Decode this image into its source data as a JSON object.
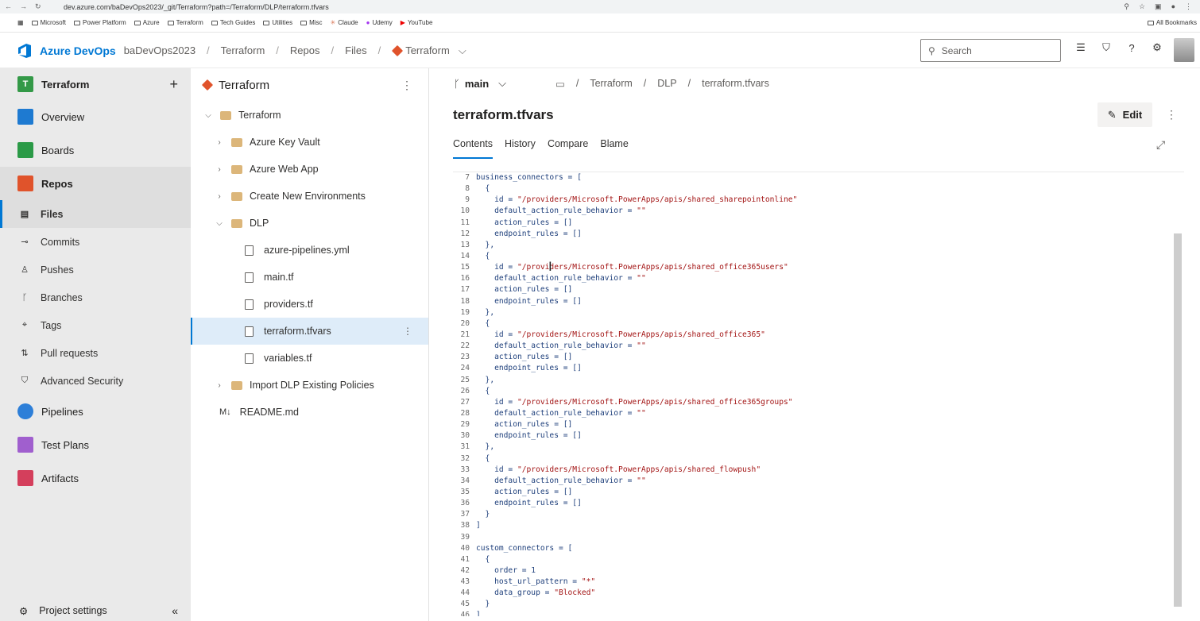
{
  "browser": {
    "url": "dev.azure.com/baDevOps2023/_git/Terraform?path=/Terraform/DLP/terraform.tfvars",
    "bookmarks": [
      "Microsoft",
      "Power Platform",
      "Azure",
      "Terraform",
      "Tech Guides",
      "Utilities",
      "Misc",
      "Claude",
      "Udemy",
      "YouTube"
    ],
    "all_bookmarks": "All Bookmarks"
  },
  "header": {
    "brand": "Azure DevOps",
    "org": "baDevOps2023",
    "project": "Terraform",
    "section": "Repos",
    "subsection": "Files",
    "repo": "Terraform",
    "search_placeholder": "Search"
  },
  "sidebar": {
    "project_initial": "T",
    "project_name": "Terraform",
    "items": {
      "overview": "Overview",
      "boards": "Boards",
      "repos": "Repos",
      "files": "Files",
      "commits": "Commits",
      "pushes": "Pushes",
      "branches": "Branches",
      "tags": "Tags",
      "pull_requests": "Pull requests",
      "advanced_security": "Advanced Security",
      "pipelines": "Pipelines",
      "test_plans": "Test Plans",
      "artifacts": "Artifacts"
    },
    "settings": "Project settings"
  },
  "tree": {
    "repo_name": "Terraform",
    "root": "Terraform",
    "folders": {
      "key_vault": "Azure Key Vault",
      "web_app": "Azure Web App",
      "new_env": "Create New Environments",
      "dlp": "DLP",
      "import": "Import DLP Existing Policies"
    },
    "files": {
      "pipelines": "azure-pipelines.yml",
      "main": "main.tf",
      "providers": "providers.tf",
      "tfvars": "terraform.tfvars",
      "variables": "variables.tf",
      "readme": "README.md"
    }
  },
  "main": {
    "branch": "main",
    "path": {
      "p1": "Terraform",
      "p2": "DLP",
      "p3": "terraform.tfvars"
    },
    "file_title": "terraform.tfvars",
    "edit_label": "Edit",
    "tabs": {
      "contents": "Contents",
      "history": "History",
      "compare": "Compare",
      "blame": "Blame"
    }
  },
  "code": {
    "n7": "7",
    "l7": "business_connectors = [",
    "n8": "8",
    "l8": "  {",
    "n9": "9",
    "l9a": "    id = ",
    "l9b": "\"/providers/Microsoft.PowerApps/apis/shared_sharepointonline\"",
    "n10": "10",
    "l10a": "    default_action_rule_behavior = ",
    "l10b": "\"\"",
    "n11": "11",
    "l11": "    action_rules = []",
    "n12": "12",
    "l12": "    endpoint_rules = []",
    "n13": "13",
    "l13": "  },",
    "n14": "14",
    "l14": "  {",
    "n15": "15",
    "l15a": "    id = ",
    "l15b": "\"/providers/Microsoft.PowerApps/apis/shared_office365users\"",
    "n16": "16",
    "l16a": "    default_action_rule_behavior = ",
    "l16b": "\"\"",
    "n17": "17",
    "l17": "    action_rules = []",
    "n18": "18",
    "l18": "    endpoint_rules = []",
    "n19": "19",
    "l19": "  },",
    "n20": "20",
    "l20": "  {",
    "n21": "21",
    "l21a": "    id = ",
    "l21b": "\"/providers/Microsoft.PowerApps/apis/shared_office365\"",
    "n22": "22",
    "l22a": "    default_action_rule_behavior = ",
    "l22b": "\"\"",
    "n23": "23",
    "l23": "    action_rules = []",
    "n24": "24",
    "l24": "    endpoint_rules = []",
    "n25": "25",
    "l25": "  },",
    "n26": "26",
    "l26": "  {",
    "n27": "27",
    "l27a": "    id = ",
    "l27b": "\"/providers/Microsoft.PowerApps/apis/shared_office365groups\"",
    "n28": "28",
    "l28a": "    default_action_rule_behavior = ",
    "l28b": "\"\"",
    "n29": "29",
    "l29": "    action_rules = []",
    "n30": "30",
    "l30": "    endpoint_rules = []",
    "n31": "31",
    "l31": "  },",
    "n32": "32",
    "l32": "  {",
    "n33": "33",
    "l33a": "    id = ",
    "l33b": "\"/providers/Microsoft.PowerApps/apis/shared_flowpush\"",
    "n34": "34",
    "l34a": "    default_action_rule_behavior = ",
    "l34b": "\"\"",
    "n35": "35",
    "l35": "    action_rules = []",
    "n36": "36",
    "l36": "    endpoint_rules = []",
    "n37": "37",
    "l37": "  }",
    "n38": "38",
    "l38": "]",
    "n39": "39",
    "l39": "",
    "n40": "40",
    "l40": "custom_connectors = [",
    "n41": "41",
    "l41": "  {",
    "n42": "42",
    "l42": "    order = 1",
    "n43": "43",
    "l43a": "    host_url_pattern = ",
    "l43b": "\"*\"",
    "n44": "44",
    "l44a": "    data_group = ",
    "l44b": "\"Blocked\"",
    "n45": "45",
    "l45": "  }",
    "n46": "46",
    "l46": "]"
  }
}
